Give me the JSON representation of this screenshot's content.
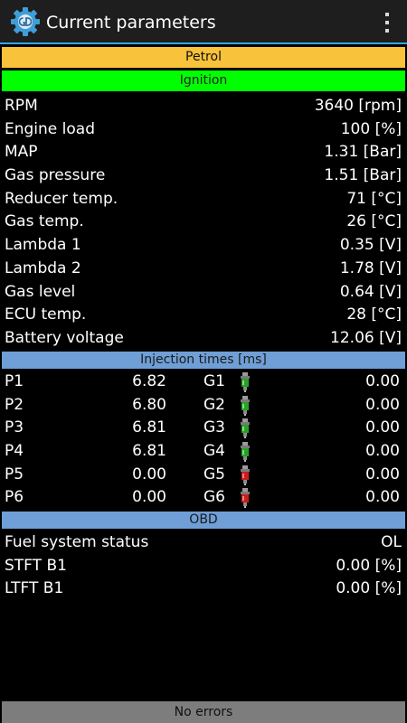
{
  "header": {
    "title": "Current parameters",
    "app_icon": "gas-ecu-gear-icon",
    "menu_icon": "overflow-menu-icon"
  },
  "fuel_bar": {
    "label": "Petrol",
    "color": "#f8c23a"
  },
  "ignition_bar": {
    "label": "Ignition",
    "color": "#00ff00"
  },
  "parameters": [
    {
      "label": "RPM",
      "value": "3640 [rpm]"
    },
    {
      "label": "Engine load",
      "value": "100 [%]"
    },
    {
      "label": "MAP",
      "value": "1.31 [Bar]"
    },
    {
      "label": "Gas pressure",
      "value": "1.51 [Bar]"
    },
    {
      "label": "Reducer temp.",
      "value": "71 [°C]"
    },
    {
      "label": "Gas temp.",
      "value": "26 [°C]"
    },
    {
      "label": "Lambda 1",
      "value": "0.35 [V]"
    },
    {
      "label": "Lambda 2",
      "value": "1.78 [V]"
    },
    {
      "label": "Gas level",
      "value": "0.64 [V]"
    },
    {
      "label": "ECU temp.",
      "value": "28 [°C]"
    },
    {
      "label": "Battery voltage",
      "value": "12.06 [V]"
    }
  ],
  "injection": {
    "title": "Injection times [ms]",
    "section_color": "#6f9fd6",
    "rows": [
      {
        "p_label": "P1",
        "p_value": "6.82",
        "g_label": "G1",
        "g_icon": "injector-green-icon",
        "g_value": "0.00"
      },
      {
        "p_label": "P2",
        "p_value": "6.80",
        "g_label": "G2",
        "g_icon": "injector-green-icon",
        "g_value": "0.00"
      },
      {
        "p_label": "P3",
        "p_value": "6.81",
        "g_label": "G3",
        "g_icon": "injector-green-icon",
        "g_value": "0.00"
      },
      {
        "p_label": "P4",
        "p_value": "6.81",
        "g_label": "G4",
        "g_icon": "injector-green-icon",
        "g_value": "0.00"
      },
      {
        "p_label": "P5",
        "p_value": "0.00",
        "g_label": "G5",
        "g_icon": "injector-red-icon",
        "g_value": "0.00"
      },
      {
        "p_label": "P6",
        "p_value": "0.00",
        "g_label": "G6",
        "g_icon": "injector-red-icon",
        "g_value": "0.00"
      }
    ],
    "injector_active_color": "#2aa02a",
    "injector_inactive_color": "#c81e1e"
  },
  "obd": {
    "title": "OBD",
    "rows": [
      {
        "label": "Fuel system status",
        "value": "OL"
      },
      {
        "label": "STFT B1",
        "value": "0.00 [%]"
      },
      {
        "label": "LTFT B1",
        "value": "0.00 [%]"
      }
    ]
  },
  "status": {
    "label": "No errors",
    "color": "#7d7d7d"
  }
}
